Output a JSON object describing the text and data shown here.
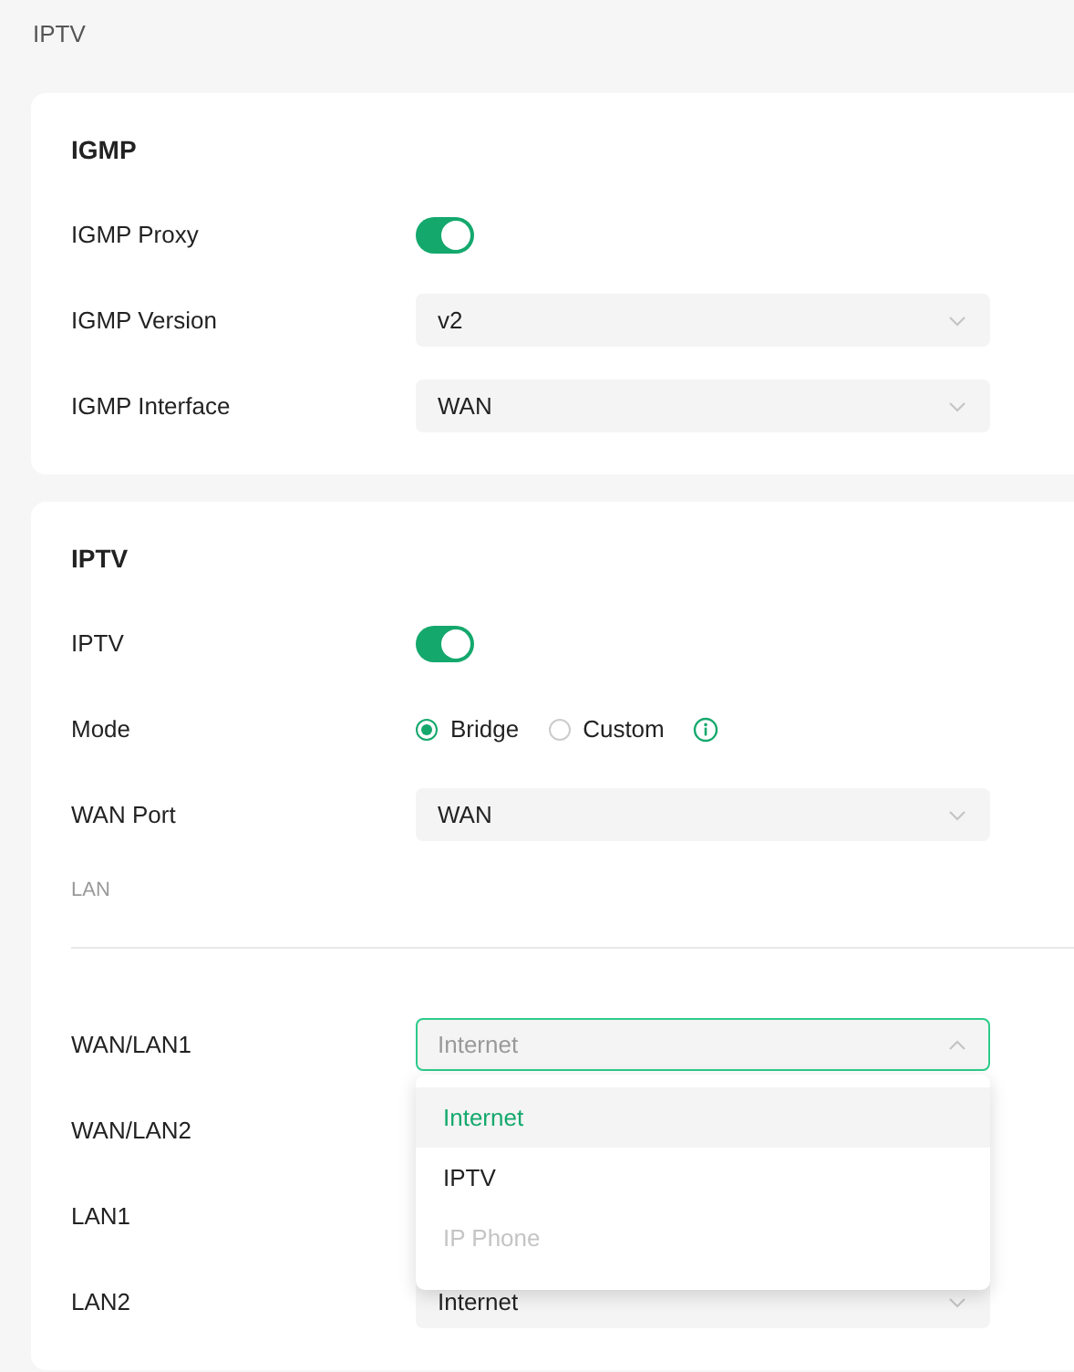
{
  "page_title": "IPTV",
  "cards": [
    {
      "heading": "IGMP",
      "rows": [
        {
          "kind": "toggle",
          "label": "IGMP Proxy",
          "on": true
        },
        {
          "kind": "select",
          "label": "IGMP Version",
          "value": "v2"
        },
        {
          "kind": "select",
          "label": "IGMP Interface",
          "value": "WAN"
        }
      ]
    },
    {
      "heading": "IPTV",
      "rows": [
        {
          "kind": "toggle",
          "label": "IPTV",
          "on": true
        },
        {
          "kind": "radio",
          "label": "Mode",
          "options": [
            {
              "label": "Bridge",
              "selected": true
            },
            {
              "label": "Custom",
              "selected": false
            }
          ],
          "info": true
        },
        {
          "kind": "select",
          "label": "WAN Port",
          "value": "WAN"
        },
        {
          "kind": "subheading",
          "label": "LAN"
        },
        {
          "kind": "select",
          "label": "WAN/LAN1",
          "value": "Internet",
          "open": true,
          "menu": [
            {
              "label": "Internet",
              "selected": true,
              "disabled": false
            },
            {
              "label": "IPTV",
              "selected": false,
              "disabled": false
            },
            {
              "label": "IP Phone",
              "selected": false,
              "disabled": true
            }
          ]
        },
        {
          "kind": "select",
          "label": "WAN/LAN2"
        },
        {
          "kind": "select",
          "label": "LAN1"
        },
        {
          "kind": "select",
          "label": "LAN2",
          "value": "Internet"
        }
      ]
    }
  ]
}
